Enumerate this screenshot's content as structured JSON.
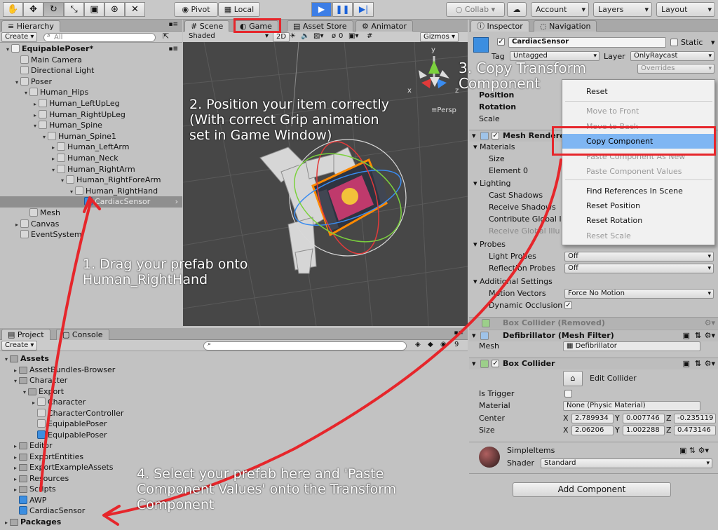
{
  "toolbar": {
    "tool_icons": [
      "hand-icon",
      "move-icon",
      "rotate-icon",
      "scale-icon",
      "rect-icon",
      "transform-icon",
      "custom-tool-icon"
    ],
    "pivot": "Pivot",
    "local": "Local",
    "collab": "Collab",
    "account": "Account",
    "layers": "Layers",
    "layout": "Layout"
  },
  "hierarchy": {
    "tab": "Hierarchy",
    "create": "Create",
    "search_placeholder": "All",
    "items": [
      {
        "label": "EquipablePoser*",
        "depth": 0
      },
      {
        "label": "Main Camera",
        "depth": 1
      },
      {
        "label": "Directional Light",
        "depth": 1
      },
      {
        "label": "Poser",
        "depth": 1
      },
      {
        "label": "Human_Hips",
        "depth": 2
      },
      {
        "label": "Human_LeftUpLeg",
        "depth": 3
      },
      {
        "label": "Human_RightUpLeg",
        "depth": 3
      },
      {
        "label": "Human_Spine",
        "depth": 3
      },
      {
        "label": "Human_Spine1",
        "depth": 4
      },
      {
        "label": "Human_LeftArm",
        "depth": 5
      },
      {
        "label": "Human_Neck",
        "depth": 5
      },
      {
        "label": "Human_RightArm",
        "depth": 5
      },
      {
        "label": "Human_RightForeArm",
        "depth": 6
      },
      {
        "label": "Human_RightHand",
        "depth": 7
      },
      {
        "label": "CardiacSensor",
        "depth": 8
      },
      {
        "label": "Mesh",
        "depth": 2
      },
      {
        "label": "Canvas",
        "depth": 1
      },
      {
        "label": "EventSystem",
        "depth": 1
      }
    ]
  },
  "scene": {
    "tabs": [
      "Scene",
      "Game",
      "Asset Store",
      "Animator"
    ],
    "shaded": "Shaded",
    "mode_2d": "2D",
    "gizmos": "Gizmos",
    "layers_count": "0",
    "persp": "Persp",
    "axis_y": "y",
    "axis_x": "x",
    "axis_z": "z"
  },
  "project": {
    "tabs": [
      "Project",
      "Console"
    ],
    "create": "Create",
    "badge_count": "9",
    "items": [
      {
        "label": "Assets",
        "depth": 0,
        "bold": true
      },
      {
        "label": "AssetBundles-Browser",
        "depth": 1
      },
      {
        "label": "Character",
        "depth": 1
      },
      {
        "label": "Export",
        "depth": 2
      },
      {
        "label": "Character",
        "depth": 3
      },
      {
        "label": "CharacterController",
        "depth": 3
      },
      {
        "label": "EquipablePoser",
        "depth": 3
      },
      {
        "label": "EquipablePoser",
        "depth": 3
      },
      {
        "label": "Editor",
        "depth": 1
      },
      {
        "label": "ExportEntities",
        "depth": 1
      },
      {
        "label": "ExportExampleAssets",
        "depth": 1
      },
      {
        "label": "Resources",
        "depth": 1
      },
      {
        "label": "Scripts",
        "depth": 1
      },
      {
        "label": "AWP",
        "depth": 1
      },
      {
        "label": "CardiacSensor",
        "depth": 1
      },
      {
        "label": "Packages",
        "depth": 0,
        "bold": true
      }
    ]
  },
  "inspector": {
    "tabs": [
      "Inspector",
      "Navigation"
    ],
    "object_name": "CardiacSensor",
    "static": "Static",
    "tag_label": "Tag",
    "tag_value": "Untagged",
    "layer_label": "Layer",
    "layer_value": "OnlyRaycast",
    "overrides": "Overrides",
    "transform": {
      "position": "Position",
      "rotation": "Rotation",
      "scale": "Scale"
    },
    "mesh_renderer": "Mesh Renderer",
    "materials": "Materials",
    "size": "Size",
    "element0": "Element 0",
    "lighting": "Lighting",
    "cast_shadows": "Cast Shadows",
    "receive_shadows": "Receive Shadows",
    "contribute_gi": "Contribute Global I",
    "receive_gi": "Receive Global Illu",
    "probes": "Probes",
    "light_probes": "Light Probes",
    "light_probes_value": "Off",
    "reflection_probes": "Reflection Probes",
    "reflection_probes_value": "Off",
    "additional_settings": "Additional Settings",
    "motion_vectors": "Motion Vectors",
    "motion_vectors_value": "Force No Motion",
    "dynamic_occlusion": "Dynamic Occlusion",
    "box_collider_removed": "Box Collider (Removed)",
    "defib_filter": "Defibrillator (Mesh Filter)",
    "mesh_label": "Mesh",
    "mesh_value": "Defibrillator",
    "box_collider": "Box Collider",
    "edit_collider": "Edit Collider",
    "is_trigger": "Is Trigger",
    "material_label": "Material",
    "material_value": "None (Physic Material)",
    "center_label": "Center",
    "center": {
      "x": "2.789934",
      "y": "0.007746",
      "z": "-0.235119"
    },
    "size_label": "Size",
    "size_vals": {
      "x": "2.06206",
      "y": "1.002288",
      "z": "0.473146"
    },
    "simple_items": "SimpleItems",
    "shader_label": "Shader",
    "shader_value": "Standard",
    "add_component": "Add Component",
    "axis_x": "X",
    "axis_y": "Y",
    "axis_z": "Z"
  },
  "context_menu": {
    "items": [
      {
        "label": "Reset",
        "disabled": false
      },
      {
        "label": "Move to Front",
        "disabled": true
      },
      {
        "label": "Move to Back",
        "disabled": true
      },
      {
        "label": "Copy Component",
        "disabled": false,
        "highlighted": true
      },
      {
        "label": "Paste Component As New",
        "disabled": true
      },
      {
        "label": "Paste Component Values",
        "disabled": true
      },
      {
        "label": "Find References In Scene",
        "disabled": false
      },
      {
        "label": "Reset Position",
        "disabled": false
      },
      {
        "label": "Reset Rotation",
        "disabled": false
      },
      {
        "label": "Reset Scale",
        "disabled": true
      }
    ]
  },
  "annotations": {
    "step1": [
      "1. Drag your prefab onto",
      "Human_RightHand"
    ],
    "step2": [
      "2. Position your item correctly",
      "(With correct Grip animation",
      "set in Game Window)"
    ],
    "step3": [
      "3. Copy Transform",
      "Component"
    ],
    "step4": [
      "4. Select your prefab here and 'Paste",
      "Component Values' onto the Transform",
      "Component"
    ]
  },
  "colors": {
    "accent_red": "#e6262b",
    "highlight_blue": "#7fb6f3",
    "play_blue": "#3d7ee6"
  }
}
